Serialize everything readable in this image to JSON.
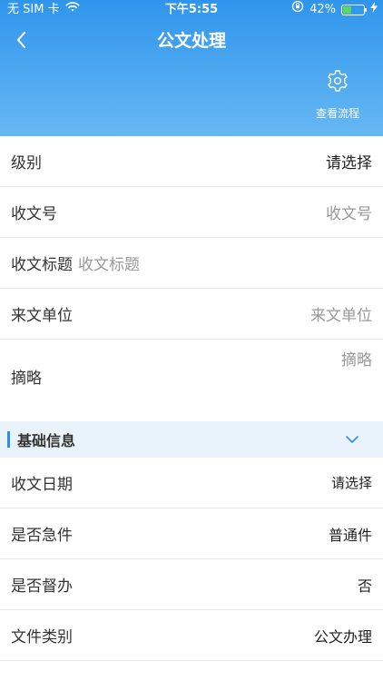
{
  "status_bar": {
    "carrier": "无 SIM 卡",
    "time": "下午5:55",
    "battery_percent": "42%",
    "battery_level": 0.42
  },
  "header": {
    "title": "公文处理",
    "action_label": "查看流程"
  },
  "form": {
    "level": {
      "label": "级别",
      "value": "请选择"
    },
    "receipt_no": {
      "label": "收文号",
      "placeholder": "收文号"
    },
    "receipt_title": {
      "label": "收文标题",
      "placeholder": "收文标题"
    },
    "sender_unit": {
      "label": "来文单位",
      "placeholder": "来文单位"
    },
    "abstract": {
      "label": "摘略",
      "placeholder": "摘略"
    }
  },
  "basic_info": {
    "title": "基础信息",
    "rows": [
      {
        "label": "收文日期",
        "value": "请选择"
      },
      {
        "label": "是否急件",
        "value": "普通件"
      },
      {
        "label": "是否督办",
        "value": "否"
      },
      {
        "label": "文件类别",
        "value": "公文办理"
      }
    ]
  },
  "colors": {
    "header_top": "#2f95ec",
    "header_bottom": "#67b8f3",
    "accent": "#2d8fea",
    "section_bg": "#e9f3fb"
  }
}
